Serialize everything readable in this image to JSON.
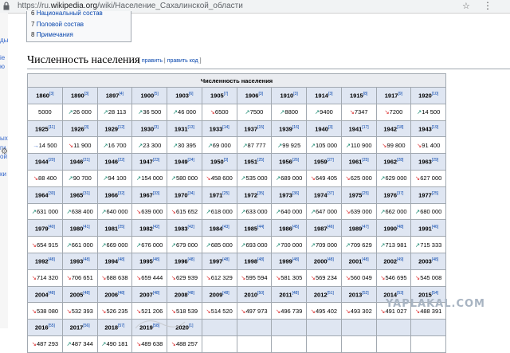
{
  "browser": {
    "url_prefix": "https://ru.",
    "url_domain": "wikipedia.org",
    "url_path": "/wiki/Население_Сахалинской_области"
  },
  "sidebar": {
    "bits": [
      "ды",
      "іе",
      "ю",
      "ых",
      "ги",
      "ой",
      "ки"
    ]
  },
  "toc": [
    {
      "num": "6",
      "label": "Национальный состав"
    },
    {
      "num": "7",
      "label": "Половой состав"
    },
    {
      "num": "8",
      "label": "Примечания"
    }
  ],
  "section": {
    "title": "Численность населения",
    "edit_open": "[",
    "edit": "править",
    "sep": "|",
    "edit_code": "править код",
    "edit_close": "]"
  },
  "table": {
    "caption": "Численность населения",
    "rows": [
      {
        "years": [
          [
            "1860",
            "3"
          ],
          [
            "1890",
            "3"
          ],
          [
            "1897",
            "4"
          ],
          [
            "1900",
            "5"
          ],
          [
            "1903",
            "6"
          ],
          [
            "1905",
            "7"
          ],
          [
            "1906",
            "3"
          ],
          [
            "1910",
            "3"
          ],
          [
            "1914",
            "3"
          ],
          [
            "1915",
            "8"
          ],
          [
            "1917",
            "9"
          ],
          [
            "1920",
            "10"
          ]
        ],
        "values": [
          [
            "5000",
            ""
          ],
          [
            "26 000",
            "up"
          ],
          [
            "28 113",
            "up"
          ],
          [
            "36 500",
            "up"
          ],
          [
            "46 000",
            "up"
          ],
          [
            "6500",
            "dn"
          ],
          [
            "7500",
            "up"
          ],
          [
            "8800",
            "up"
          ],
          [
            "9400",
            "up"
          ],
          [
            "7347",
            "dn"
          ],
          [
            "7200",
            "dn"
          ],
          [
            "14 500",
            "up"
          ]
        ]
      },
      {
        "years": [
          [
            "1925",
            "11"
          ],
          [
            "1926",
            "3"
          ],
          [
            "1929",
            "12"
          ],
          [
            "1930",
            "3"
          ],
          [
            "1931",
            "13"
          ],
          [
            "1933",
            "14"
          ],
          [
            "1937",
            "15"
          ],
          [
            "1939",
            "16"
          ],
          [
            "1940",
            "3"
          ],
          [
            "1941",
            "17"
          ],
          [
            "1942",
            "18"
          ],
          [
            "1943",
            "19"
          ]
        ],
        "values": [
          [
            "14 500",
            "eq"
          ],
          [
            "11 900",
            "dn"
          ],
          [
            "16 700",
            "up"
          ],
          [
            "23 300",
            "up"
          ],
          [
            "30 395",
            "up"
          ],
          [
            "69 000",
            "up"
          ],
          [
            "87 777",
            "up"
          ],
          [
            "99 925",
            "up"
          ],
          [
            "105 000",
            "up"
          ],
          [
            "110 900",
            "up"
          ],
          [
            "99 800",
            "dn"
          ],
          [
            "91 400",
            "dn"
          ]
        ]
      },
      {
        "years": [
          [
            "1944",
            "20"
          ],
          [
            "1946",
            "21"
          ],
          [
            "1946",
            "22"
          ],
          [
            "1947",
            "23"
          ],
          [
            "1949",
            "24"
          ],
          [
            "1950",
            "3"
          ],
          [
            "1951",
            "25"
          ],
          [
            "1956",
            "26"
          ],
          [
            "1959",
            "27"
          ],
          [
            "1961",
            "25"
          ],
          [
            "1962",
            "28"
          ],
          [
            "1963",
            "29"
          ]
        ],
        "values": [
          [
            "88 400",
            "dn"
          ],
          [
            "90 700",
            "up"
          ],
          [
            "94 100",
            "up"
          ],
          [
            "154 000",
            "up"
          ],
          [
            "580 000",
            "up"
          ],
          [
            "458 600",
            "dn"
          ],
          [
            "535 000",
            "up"
          ],
          [
            "689 000",
            "up"
          ],
          [
            "649 405",
            "dn"
          ],
          [
            "625 000",
            "dn"
          ],
          [
            "629 000",
            "up"
          ],
          [
            "627 000",
            "dn"
          ]
        ]
      },
      {
        "years": [
          [
            "1964",
            "30"
          ],
          [
            "1965",
            "31"
          ],
          [
            "1966",
            "32"
          ],
          [
            "1967",
            "33"
          ],
          [
            "1970",
            "34"
          ],
          [
            "1971",
            "25"
          ],
          [
            "1972",
            "35"
          ],
          [
            "1973",
            "36"
          ],
          [
            "1974",
            "37"
          ],
          [
            "1975",
            "25"
          ],
          [
            "1976",
            "37"
          ],
          [
            "1977",
            "25"
          ]
        ],
        "values": [
          [
            "631 000",
            "up"
          ],
          [
            "638 400",
            "up"
          ],
          [
            "640 000",
            "up"
          ],
          [
            "639 000",
            "dn"
          ],
          [
            "615 652",
            "dn"
          ],
          [
            "618 000",
            "up"
          ],
          [
            "633 000",
            "up"
          ],
          [
            "640 000",
            "up"
          ],
          [
            "647 000",
            "up"
          ],
          [
            "639 000",
            "dn"
          ],
          [
            "662 000",
            "up"
          ],
          [
            "680 000",
            "up"
          ]
        ]
      },
      {
        "years": [
          [
            "1979",
            "40"
          ],
          [
            "1980",
            "41"
          ],
          [
            "1981",
            "25"
          ],
          [
            "1982",
            "42"
          ],
          [
            "1983",
            "42"
          ],
          [
            "1984",
            "43"
          ],
          [
            "1985",
            "44"
          ],
          [
            "1986",
            "45"
          ],
          [
            "1987",
            "46"
          ],
          [
            "1989",
            "47"
          ],
          [
            "1990",
            "48"
          ],
          [
            "1991",
            "46"
          ]
        ],
        "values": [
          [
            "654 915",
            "dn"
          ],
          [
            "661 000",
            "up"
          ],
          [
            "669 000",
            "up"
          ],
          [
            "676 000",
            "up"
          ],
          [
            "679 000",
            "up"
          ],
          [
            "685 000",
            "up"
          ],
          [
            "693 000",
            "up"
          ],
          [
            "700 000",
            "up"
          ],
          [
            "709 000",
            "up"
          ],
          [
            "709 629",
            "up"
          ],
          [
            "713 981",
            "up"
          ],
          [
            "715 333",
            "up"
          ]
        ]
      },
      {
        "years": [
          [
            "1992",
            "48"
          ],
          [
            "1993",
            "48"
          ],
          [
            "1994",
            "48"
          ],
          [
            "1995",
            "48"
          ],
          [
            "1996",
            "48"
          ],
          [
            "1997",
            "48"
          ],
          [
            "1998",
            "48"
          ],
          [
            "1999",
            "48"
          ],
          [
            "2000",
            "48"
          ],
          [
            "2001",
            "48"
          ],
          [
            "2002",
            "49"
          ],
          [
            "2003",
            "48"
          ]
        ],
        "values": [
          [
            "714 320",
            "dn"
          ],
          [
            "706 651",
            "dn"
          ],
          [
            "688 638",
            "dn"
          ],
          [
            "659 444",
            "dn"
          ],
          [
            "629 939",
            "dn"
          ],
          [
            "612 329",
            "dn"
          ],
          [
            "595 594",
            "dn"
          ],
          [
            "581 305",
            "dn"
          ],
          [
            "569 234",
            "dn"
          ],
          [
            "560 049",
            "dn"
          ],
          [
            "546 695",
            "dn"
          ],
          [
            "545 008",
            "dn"
          ]
        ]
      },
      {
        "years": [
          [
            "2004",
            "48"
          ],
          [
            "2005",
            "48"
          ],
          [
            "2006",
            "48"
          ],
          [
            "2007",
            "48"
          ],
          [
            "2008",
            "48"
          ],
          [
            "2009",
            "48"
          ],
          [
            "2010",
            "50"
          ],
          [
            "2011",
            "48"
          ],
          [
            "2012",
            "51"
          ],
          [
            "2013",
            "52"
          ],
          [
            "2014",
            "53"
          ],
          [
            "2015",
            "54"
          ]
        ],
        "values": [
          [
            "538 080",
            "dn"
          ],
          [
            "532 393",
            "dn"
          ],
          [
            "526 235",
            "dn"
          ],
          [
            "521 206",
            "dn"
          ],
          [
            "518 539",
            "dn"
          ],
          [
            "514 520",
            "dn"
          ],
          [
            "497 973",
            "dn"
          ],
          [
            "496 739",
            "dn"
          ],
          [
            "495 402",
            "dn"
          ],
          [
            "493 302",
            "dn"
          ],
          [
            "491 027",
            "dn"
          ],
          [
            "488 391",
            "dn"
          ]
        ]
      },
      {
        "years": [
          [
            "2016",
            "55"
          ],
          [
            "2017",
            "56"
          ],
          [
            "2018",
            "57"
          ],
          [
            "2019",
            "58"
          ],
          [
            "2020",
            "1"
          ],
          [
            "",
            ""
          ],
          [
            "",
            ""
          ],
          [
            "",
            ""
          ],
          [
            "",
            ""
          ],
          [
            "",
            ""
          ],
          [
            "",
            ""
          ],
          [
            "",
            ""
          ]
        ],
        "values": [
          [
            "487 293",
            "dn"
          ],
          [
            "487 344",
            "up"
          ],
          [
            "490 181",
            "up"
          ],
          [
            "489 638",
            "dn"
          ],
          [
            "488 257",
            "dn"
          ],
          [
            "",
            ""
          ],
          [
            "",
            ""
          ],
          [
            "",
            ""
          ],
          [
            "",
            ""
          ],
          [
            "",
            ""
          ],
          [
            "",
            ""
          ],
          [
            "",
            ""
          ]
        ]
      }
    ]
  },
  "watermark": "YAPLAKAL.COM",
  "glyphs": {
    "up": "↗",
    "dn": "↘",
    "eq": "→",
    "star": "☆",
    "menu": "⋮",
    "gear": "⚙"
  },
  "colors": {
    "up": "#14866d",
    "down": "#d33333",
    "link": "#0645ad",
    "header_bg": "#dfe6f2"
  }
}
